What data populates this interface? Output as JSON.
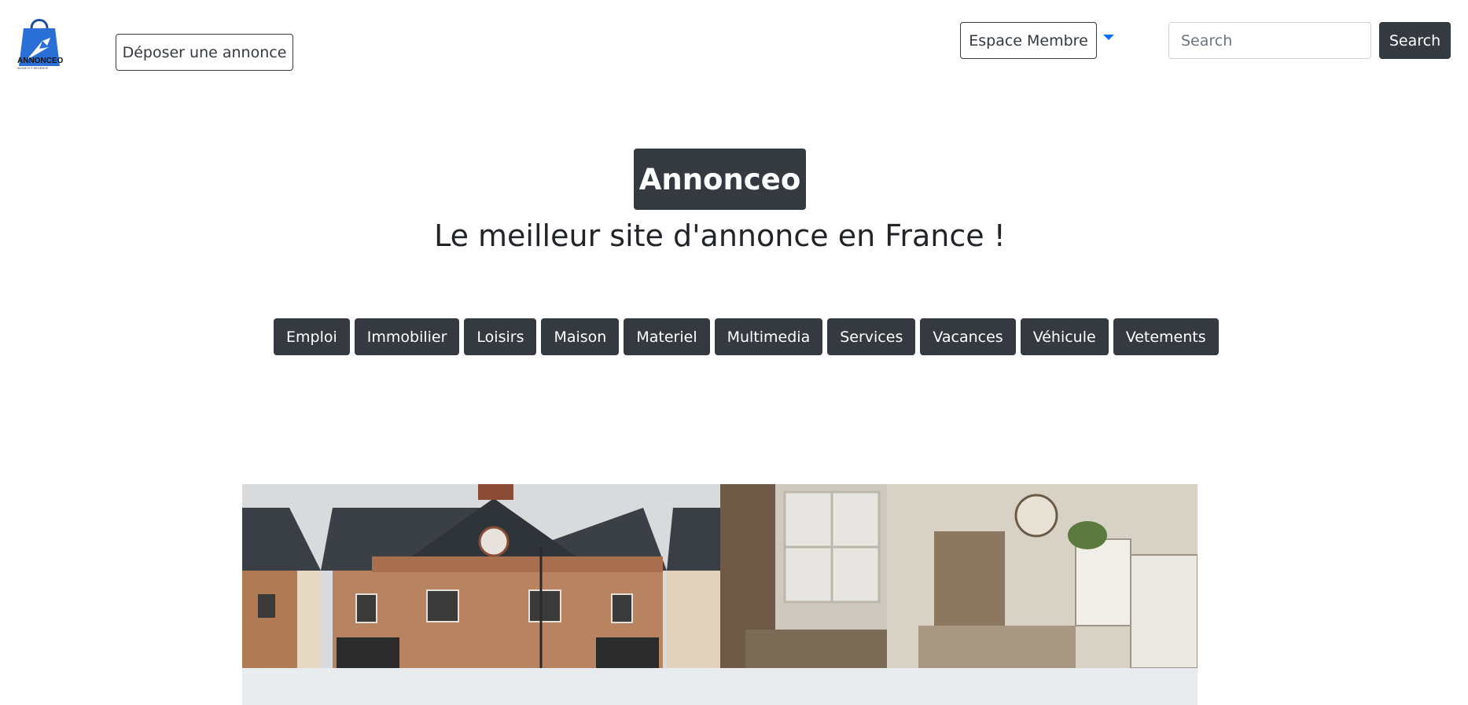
{
  "header": {
    "logo_text": "ANNONCEO",
    "logo_subtext": "ACHAT ET REVENTE",
    "post_ad_label": "Déposer une annonce",
    "member_label": "Espace Membre",
    "search_placeholder": "Search",
    "search_button_label": "Search"
  },
  "hero": {
    "brand": "Annonceo",
    "tagline": "Le meilleur site d'annonce en France !"
  },
  "categories": [
    "Emploi",
    "Immobilier",
    "Loisirs",
    "Maison",
    "Materiel",
    "Multimedia",
    "Services",
    "Vacances",
    "Véhicule",
    "Vetements"
  ],
  "colors": {
    "dark": "#343a40",
    "accent": "#0d6efd",
    "logo_blue": "#2a6fd6",
    "panel": "#e9ecef"
  },
  "icons": {
    "logo": "shopping-bag-cursor-icon",
    "caret": "caret-down-icon"
  }
}
